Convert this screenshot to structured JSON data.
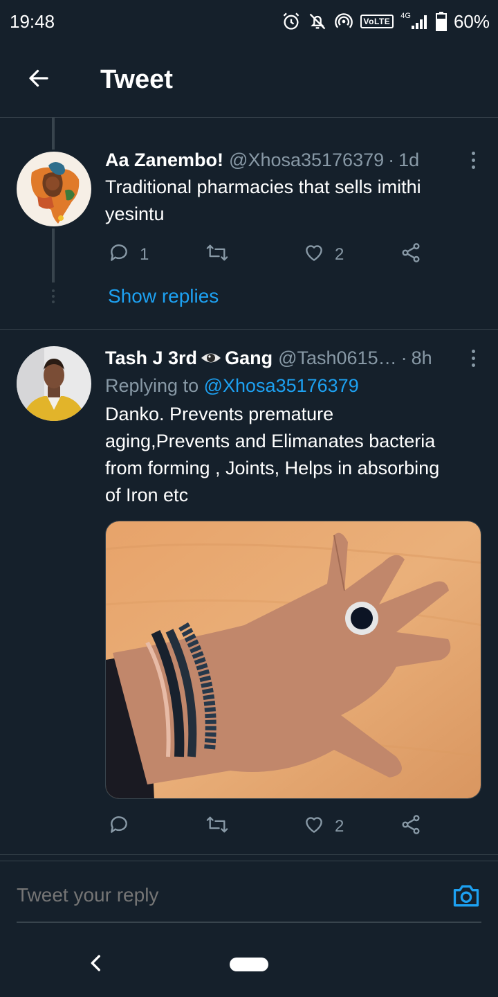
{
  "status_bar": {
    "time": "19:48",
    "volte": "VoLTE",
    "network": "4G",
    "battery": "60%"
  },
  "app_bar": {
    "title": "Tweet"
  },
  "tweets": [
    {
      "display_name": "Aa Zanembo!",
      "handle": "@Xhosa35176379",
      "separator": "·",
      "time": "1d",
      "text_lines": [
        "Traditional pharmacies that sells imithi",
        "yesintu"
      ],
      "reply_count": "1",
      "retweet_count": "",
      "like_count": "2",
      "show_replies": "Show replies"
    },
    {
      "display_name_part1": "Tash J 3rd",
      "display_name_part2": "Gang",
      "handle": "@Tash0615…",
      "separator": "·",
      "time": "8h",
      "replying_prefix": "Replying to",
      "replying_to": "@Xhosa35176379",
      "text_lines": [
        "Danko. Prevents premature",
        "aging,Prevents and Elimanates bacteria",
        "from forming , Joints, Helps in absorbing",
        "of Iron etc"
      ],
      "reply_count": "",
      "retweet_count": "",
      "like_count": "2"
    }
  ],
  "reply_bar": {
    "placeholder": "Tweet your reply"
  },
  "icons": {
    "back": "arrow-left-icon",
    "reply": "comment-icon",
    "retweet": "retweet-icon",
    "like": "heart-icon",
    "share": "share-icon",
    "camera": "camera-icon"
  },
  "colors": {
    "background": "#15202b",
    "accent": "#1da1f2",
    "secondary_text": "#8899a6",
    "divider": "#38444d"
  }
}
